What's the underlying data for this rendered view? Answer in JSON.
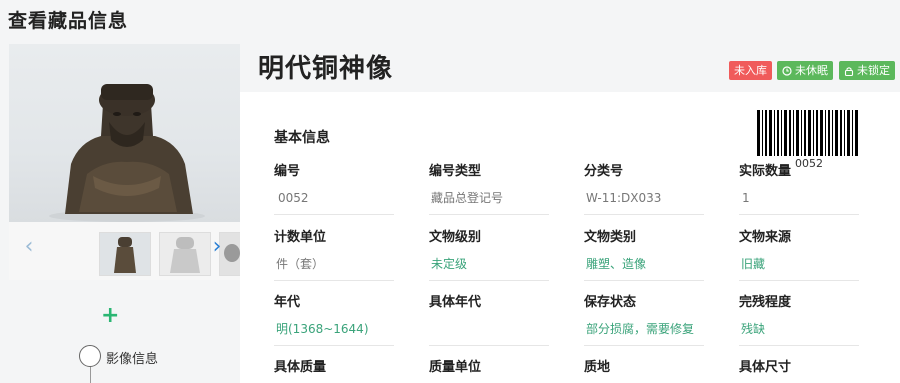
{
  "page": {
    "title": "查看藏品信息"
  },
  "object": {
    "name": "明代铜神像"
  },
  "badges": [
    {
      "label": "未入库",
      "color": "#f05b5b"
    },
    {
      "label": "未休眠",
      "color": "#5cb85c",
      "icon": "clock-icon"
    },
    {
      "label": "未锁定",
      "color": "#5cb85c",
      "icon": "lock-icon"
    }
  ],
  "barcode": {
    "number": "0052"
  },
  "section": {
    "title": "基本信息"
  },
  "fields": [
    {
      "label": "编号",
      "value": "0052"
    },
    {
      "label": "编号类型",
      "value": "藏品总登记号"
    },
    {
      "label": "分类号",
      "value": "W-11:DX033"
    },
    {
      "label": "实际数量",
      "value": "1"
    },
    {
      "label": "计数单位",
      "value": "件（套）"
    },
    {
      "label": "文物级别",
      "value": "未定级"
    },
    {
      "label": "文物类别",
      "value": "雕塑、造像"
    },
    {
      "label": "文物来源",
      "value": "旧藏"
    },
    {
      "label": "年代",
      "value": "明(1368~1644)"
    },
    {
      "label": "具体年代",
      "value": ""
    },
    {
      "label": "保存状态",
      "value": "部分损腐，需要修复"
    },
    {
      "label": "完残程度",
      "value": "残缺"
    },
    {
      "label": "具体质量",
      "value": ""
    },
    {
      "label": "质量单位",
      "value": ""
    },
    {
      "label": "质地",
      "value": ""
    },
    {
      "label": "具体尺寸",
      "value": ""
    }
  ],
  "tree": {
    "label": "影像信息"
  },
  "colors": {
    "accent_green": "#3aa37a",
    "badge_red": "#f05b5b",
    "badge_green": "#5cb85c",
    "nav_blue": "#2a7fd4"
  }
}
